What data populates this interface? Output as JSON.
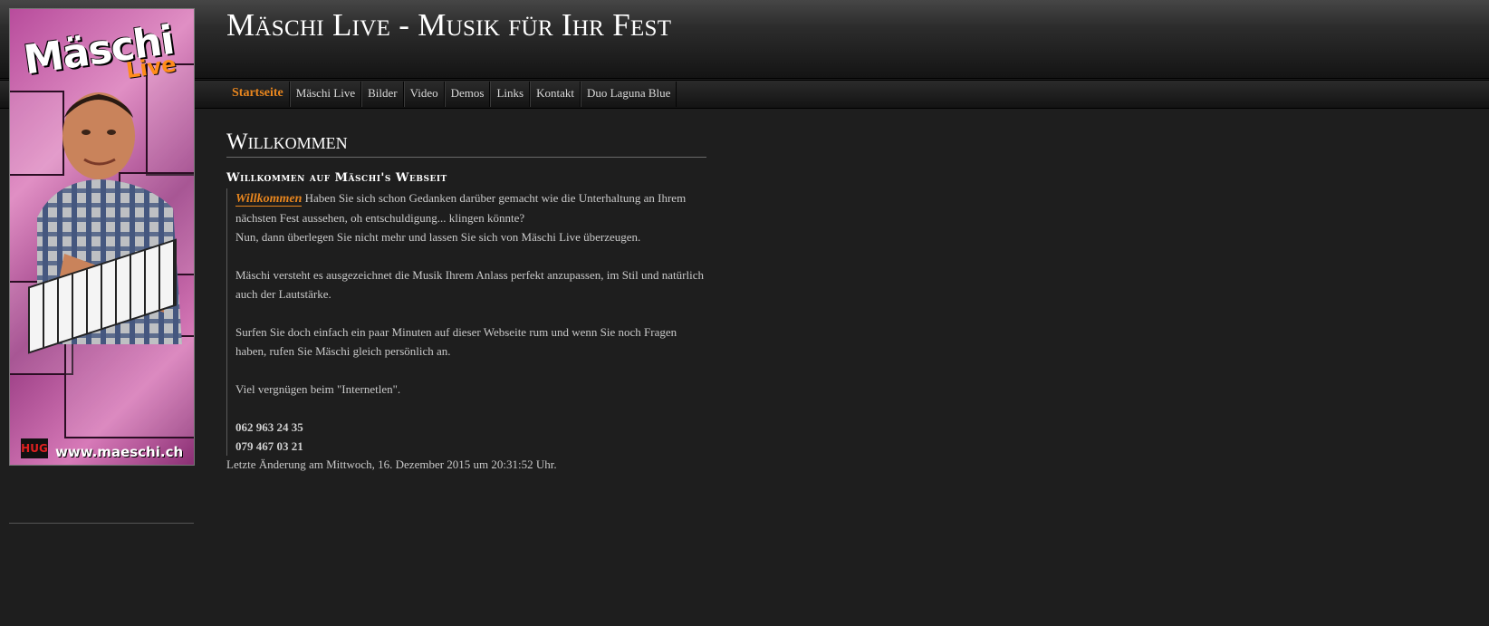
{
  "header": {
    "site_title": "Mäschi Live - Musik für Ihr Fest"
  },
  "nav": {
    "items": [
      {
        "label": "Startseite",
        "active": true
      },
      {
        "label": "Mäschi Live",
        "active": false
      },
      {
        "label": "Bilder",
        "active": false
      },
      {
        "label": "Video",
        "active": false
      },
      {
        "label": "Demos",
        "active": false
      },
      {
        "label": "Links",
        "active": false
      },
      {
        "label": "Kontakt",
        "active": false
      },
      {
        "label": "Duo Laguna Blue",
        "active": false
      }
    ]
  },
  "sidebar": {
    "banner": {
      "logo_word": "Mäschi",
      "logo_sub": "Live",
      "badge": "HUG",
      "url": "www.maeschi.ch"
    }
  },
  "content": {
    "heading": "Willkommen",
    "subheading": "Willkommen auf Mäschi's Webseit",
    "welcome_link": "Willkommen",
    "intro_text": " Haben Sie sich schon Gedanken darüber gemacht wie die Unterhaltung an Ihrem nächsten Fest aussehen, oh entschuldigung... klingen könnte?",
    "line2": "Nun, dann überlegen Sie nicht mehr und lassen Sie sich von Mäschi Live überzeugen.",
    "para2": "Mäschi versteht es ausgezeichnet die Musik Ihrem Anlass perfekt anzupassen, im Stil und natürlich auch der Lautstärke.",
    "para3": "Surfen Sie doch einfach ein paar Minuten auf dieser Webseite rum und wenn Sie noch Fragen haben, rufen Sie Mäschi gleich persönlich an.",
    "para4": "Viel vergnügen beim \"Internetlen\".",
    "phone1": "062 963 24 35",
    "phone2": "079 467 03 21",
    "last_modified": "Letzte Änderung am Mittwoch, 16. Dezember 2015 um 20:31:52 Uhr."
  },
  "colors": {
    "background": "#1e1e1e",
    "accent": "#e8861e",
    "text": "#c9c9c9",
    "heading": "#ffffff"
  }
}
